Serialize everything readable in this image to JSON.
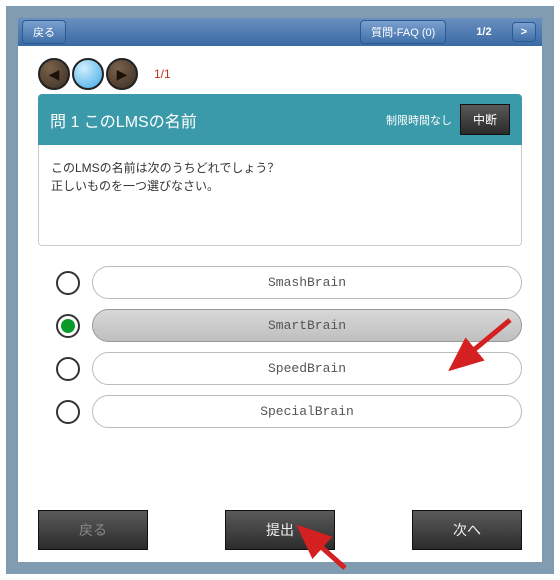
{
  "topbar": {
    "back_label": "戻る",
    "faq_label": "質問-FAQ (0)",
    "page_indicator": "1/2",
    "next_label": ">"
  },
  "nav_orbs": {
    "counter": "1/1"
  },
  "question": {
    "title": "問 1  このLMSの名前",
    "time_limit": "制限時間なし",
    "abort_label": "中断",
    "body_line1": "このLMSの名前は次のうちどれでしょう？",
    "body_line2": "正しいものを一つ選びなさい。"
  },
  "options": [
    {
      "label": "SmashBrain",
      "selected": false
    },
    {
      "label": "SmartBrain",
      "selected": true
    },
    {
      "label": "SpeedBrain",
      "selected": false
    },
    {
      "label": "SpecialBrain",
      "selected": false
    }
  ],
  "bottom": {
    "back_label": "戻る",
    "submit_label": "提出",
    "next_label": "次へ"
  },
  "colors": {
    "frame": "#819cb0",
    "header": "#3b9aa9",
    "radio_selected": "#0a9a2a",
    "arrow": "#d42020"
  }
}
